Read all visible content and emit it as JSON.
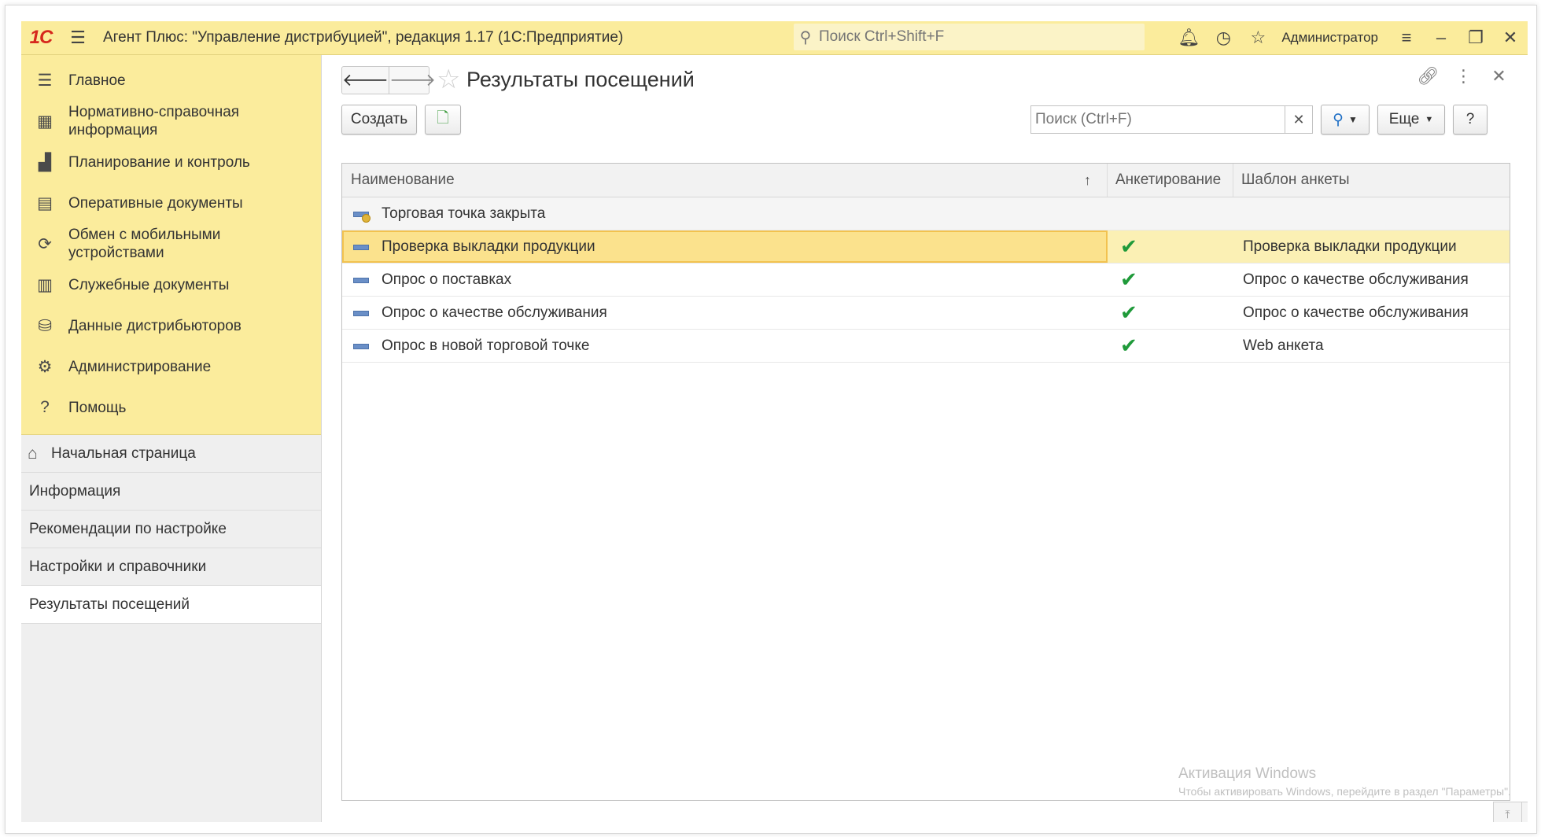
{
  "titlebar": {
    "logo": "1С",
    "app_title": "Агент Плюс: \"Управление дистрибуцией\", редакция 1.17  (1С:Предприятие)",
    "search_placeholder": "Поиск Ctrl+Shift+F",
    "user": "Администратор"
  },
  "sidebar": {
    "sections": [
      {
        "label": "Главное",
        "icon": "list-icon"
      },
      {
        "label": "Нормативно-справочная информация",
        "icon": "grid-icon"
      },
      {
        "label": "Планирование и контроль",
        "icon": "chart-icon"
      },
      {
        "label": "Оперативные документы",
        "icon": "documents-icon"
      },
      {
        "label": "Обмен с мобильными устройствами",
        "icon": "sync-icon"
      },
      {
        "label": "Служебные документы",
        "icon": "service-docs-icon"
      },
      {
        "label": "Данные дистрибьюторов",
        "icon": "distributor-icon"
      },
      {
        "label": "Администрирование",
        "icon": "gear-icon"
      },
      {
        "label": "Помощь",
        "icon": "question-icon"
      }
    ],
    "open_windows": [
      {
        "label": "Начальная страница",
        "icon": "home-icon"
      },
      {
        "label": "Информация"
      },
      {
        "label": "Рекомендации по настройке"
      },
      {
        "label": "Настройки и справочники"
      },
      {
        "label": "Результаты посещений"
      }
    ]
  },
  "main": {
    "title": "Результаты посещений",
    "create_label": "Создать",
    "search_placeholder": "Поиск (Ctrl+F)",
    "more_label": "Еще",
    "help_label": "?",
    "columns": [
      "Наименование",
      "Анкетирование",
      "Шаблон анкеты"
    ],
    "rows": [
      {
        "name": "Торговая точка закрыта",
        "survey": false,
        "template": ""
      },
      {
        "name": "Проверка выкладки продукции",
        "survey": true,
        "template": "Проверка выкладки продукции"
      },
      {
        "name": "Опрос о поставках",
        "survey": true,
        "template": "Опрос о качестве обслуживания"
      },
      {
        "name": "Опрос о качестве обслуживания",
        "survey": true,
        "template": "Опрос о качестве обслуживания"
      },
      {
        "name": "Опрос в новой торговой точке",
        "survey": true,
        "template": "Web анкета"
      }
    ],
    "selected_row": 1,
    "watermark_title": "Активация Windows",
    "watermark_text": "Чтобы активировать Windows, перейдите в раздел \"Параметры\"."
  },
  "colors": {
    "accent": "#fbec9c",
    "selection": "#fbf0b4",
    "check": "#1f9a3a"
  }
}
